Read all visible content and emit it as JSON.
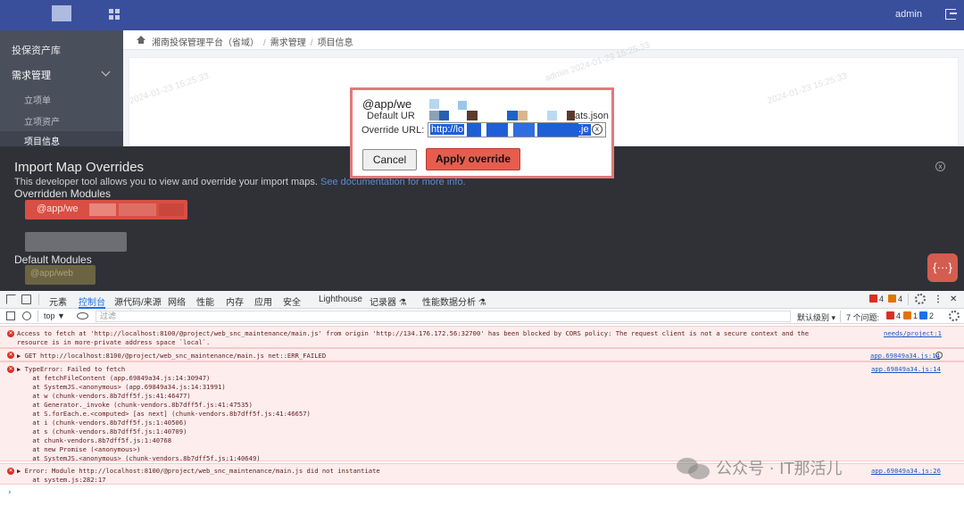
{
  "header": {
    "user": "admin"
  },
  "sidebar": {
    "items": [
      {
        "label": "投保资产库"
      },
      {
        "label": "需求管理"
      },
      {
        "label": "立项单"
      },
      {
        "label": "立项资产"
      },
      {
        "label": "项目信息"
      }
    ]
  },
  "breadcrumb": {
    "items": [
      "湘南投保管理平台（省域）",
      "需求管理",
      "项目信息"
    ],
    "separator": "/"
  },
  "watermarks": [
    "admin 2024-01-23 15:25:33",
    "2024-01-23 15:25:33",
    "2024-01-23 15:25:33"
  ],
  "import_map_panel": {
    "title": "Import Map Overrides",
    "description": "This developer tool allows you to view and override your import maps. ",
    "docs_link": "See documentation for more info.",
    "overridden_heading": "Overridden Modules",
    "overridden_module": "@app/we",
    "default_heading": "Default Modules",
    "default_module": "@app/web",
    "more_button": "{···}"
  },
  "dialog": {
    "module_name": "@app/we",
    "default_url_label": "Default UR",
    "default_url_suffix": "ats.json",
    "override_url_label": "Override URL:",
    "override_url_value": "http://lo",
    "override_url_tail": ".je",
    "clear_icon": "ⓧ",
    "cancel_label": "Cancel",
    "apply_label": "Apply override"
  },
  "devtools": {
    "tabs": [
      "元素",
      "控制台",
      "源代码/来源",
      "网络",
      "性能",
      "内存",
      "应用",
      "安全",
      "Lighthouse",
      "记录器 ⚗",
      "性能数据分析 ⚗"
    ],
    "active_tab": "控制台",
    "error_count": "4",
    "warning_count": "4",
    "context": "top",
    "filter_placeholder": "过滤",
    "level_label": "默认级别 ▾",
    "issues_label": "7 个问题:",
    "issue_errors": "4",
    "issue_warnings": "1",
    "issue_info": "2",
    "colors": {
      "accent": "#1a73e8",
      "error": "#d93025",
      "error_bg": "#fdeded"
    }
  },
  "console": {
    "messages": [
      {
        "lines": [
          "Access to fetch at 'http://localhost:8100/@project/web_snc_maintenance/main.js' from origin 'http://134.176.172.56:32700' has been blocked by CORS policy: The request client is not a secure context and the",
          "resource is in more-private address space `local`."
        ],
        "source": "needs/project:1"
      },
      {
        "lines": [
          "▶ GET http://localhost:8100/@project/web_snc_maintenance/main.js net::ERR_FAILED"
        ],
        "source": "app.69849a34.js:14"
      },
      {
        "lines": [
          "▶ TypeError: Failed to fetch",
          "    at fetchFileContent (app.69849a34.js:14:30947)",
          "    at SystemJS.<anonymous> (app.69849a34.js:14:31991)",
          "    at w (chunk-vendors.8b7dff5f.js:41:46477)",
          "    at Generator._invoke (chunk-vendors.8b7dff5f.js:41:47535)",
          "    at S.forEach.e.<computed> [as next] (chunk-vendors.8b7dff5f.js:41:46657)",
          "    at i (chunk-vendors.8b7dff5f.js:1:40506)",
          "    at s (chunk-vendors.8b7dff5f.js:1:40709)",
          "    at chunk-vendors.8b7dff5f.js:1:40768",
          "    at new Promise (<anonymous>)",
          "    at SystemJS.<anonymous> (chunk-vendors.8b7dff5f.js:1:40649)"
        ],
        "source": "app.69849a34.js:14"
      },
      {
        "lines": [
          "▶ Error: Module http://localhost:8100/@project/web_snc_maintenance/main.js did not instantiate",
          "    at system.js:282:17"
        ],
        "source": "app.69849a34.js:26"
      }
    ],
    "prompt": "›"
  },
  "watermark_brand": "公众号 · IT那活儿"
}
